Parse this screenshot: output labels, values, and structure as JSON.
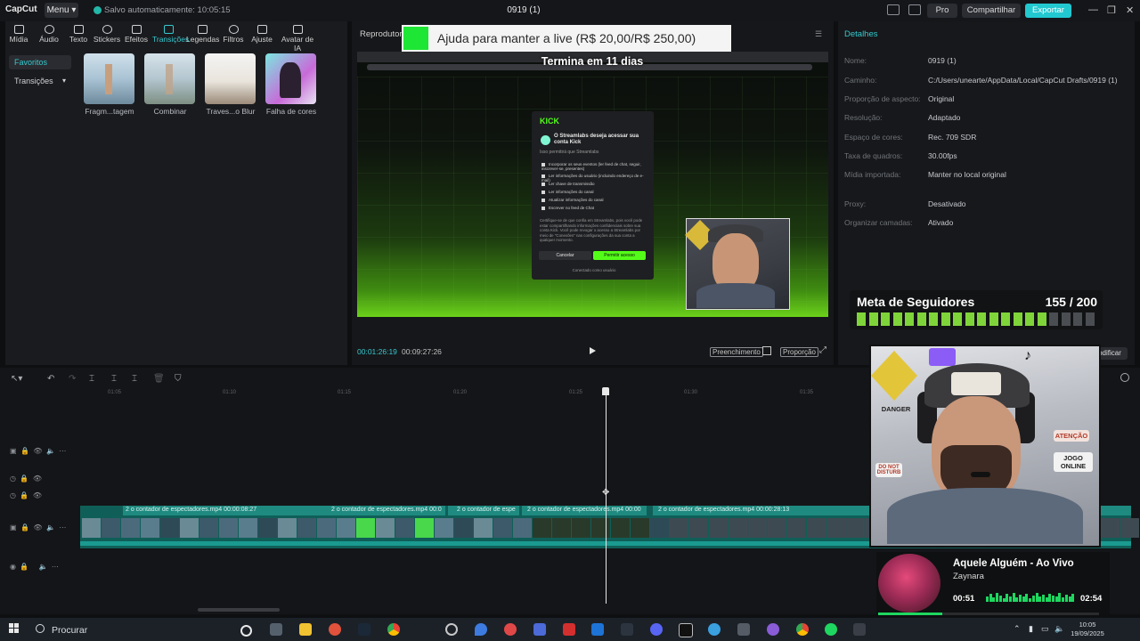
{
  "app": {
    "logo": "CapCut",
    "menu_label": "Menu",
    "autosave": "Salvo automaticamente: 10:05:15",
    "project_title": "0919 (1)"
  },
  "top_buttons": {
    "pro": "Pro",
    "share": "Compartilhar",
    "export": "Exportar"
  },
  "toolbar": [
    "Mídia",
    "Áudio",
    "Texto",
    "Stickers",
    "Efeitos",
    "Transições",
    "Legendas",
    "Filtros",
    "Ajuste",
    "Avatar de IA"
  ],
  "categories": {
    "selected": "Favoritos",
    "other": "Transições"
  },
  "transitions": [
    "Fragm...tagem",
    "Combinar",
    "Traves...o Blur",
    "Falha de cores"
  ],
  "player": {
    "title": "Reprodutor",
    "current_time": "00:01:26:19",
    "total_time": "00:09:27:26",
    "fill_label": "Preenchimento",
    "ratio_label": "Proporção"
  },
  "overlay": {
    "donation": "Ajuda para manter a live (R$ 20,00/R$ 250,00)",
    "ends": "Termina em 11 dias"
  },
  "kick_dialog": {
    "logo": "KICK",
    "title": "O Streamlabs deseja acessar sua conta Kick",
    "subtitle": "Isso permitirá que Streamlabs",
    "permissions": [
      "Incorporar os seus eventos (ler feed de chat, seguir, inscrever-se, presentes)",
      "Ler informações do usuário (incluindo endereço de e-mail)",
      "Ler chave de transmissão",
      "Ler informações do canal",
      "Atualizar informações do canal",
      "Escrever no feed de Chat"
    ],
    "note": "Certifique-se de que confia em Streamlabs, pois você pode estar compartilhando informações confidenciais sobre sua conta Kick. Você pode revogar o acesso a Streamlabs por meio de \"Conexões\" nas configurações da sua conta a qualquer momento.",
    "cancel": "Cancelar",
    "allow": "Permitir acesso",
    "footer": "Conectado como usuário"
  },
  "details": {
    "title": "Detalhes",
    "rows": [
      {
        "label": "Nome:",
        "value": "0919 (1)"
      },
      {
        "label": "Caminho:",
        "value": "C:/Users/unearte/AppData/Local/CapCut Drafts/0919 (1)"
      },
      {
        "label": "Proporção de aspecto:",
        "value": "Original"
      },
      {
        "label": "Resolução:",
        "value": "Adaptado"
      },
      {
        "label": "Espaço de cores:",
        "value": "Rec. 709 SDR"
      },
      {
        "label": "Taxa de quadros:",
        "value": "30.00fps"
      },
      {
        "label": "Mídia importada:",
        "value": "Manter no local original"
      },
      {
        "label": "Proxy:",
        "value": "Desativado"
      },
      {
        "label": "Organizar camadas:",
        "value": "Ativado"
      }
    ],
    "modify": "odificar"
  },
  "goal": {
    "label": "Meta de Seguidores",
    "count": "155 / 200",
    "progress": 0.775,
    "fill_color": "#7fd43a",
    "empty_color": "#4a4d52"
  },
  "timeline": {
    "ticks": [
      "01:05",
      "01:10",
      "01:15",
      "01:20",
      "01:25",
      "01:30",
      "01:35"
    ],
    "clips": [
      "2 o contador de espectadores.mp4   00:00:08:27",
      "2 o contador de espectadores.mp4   00:0",
      "2 o contador de espe",
      "2 o contador de espectadores.mp4   00:00",
      "2 o contador de espectadores.mp4   00:00:28:13"
    ]
  },
  "webcam_stickers": {
    "danger": "DANGER",
    "attention": "ATENÇÃO",
    "online": "JOGO ONLINE",
    "disturb": "DO NOT DISTURB"
  },
  "music": {
    "title": "Aquele Alguém - Ao Vivo",
    "artist": "Zaynara",
    "elapsed": "00:51",
    "duration": "02:54",
    "progress": 0.29
  },
  "taskbar": {
    "search": "Procurar",
    "time": "10:05",
    "date": "19/09/2025"
  },
  "colors": {
    "accent": "#35c9cf",
    "kick_green": "#53fc18",
    "spotify_green": "#1ed760"
  }
}
